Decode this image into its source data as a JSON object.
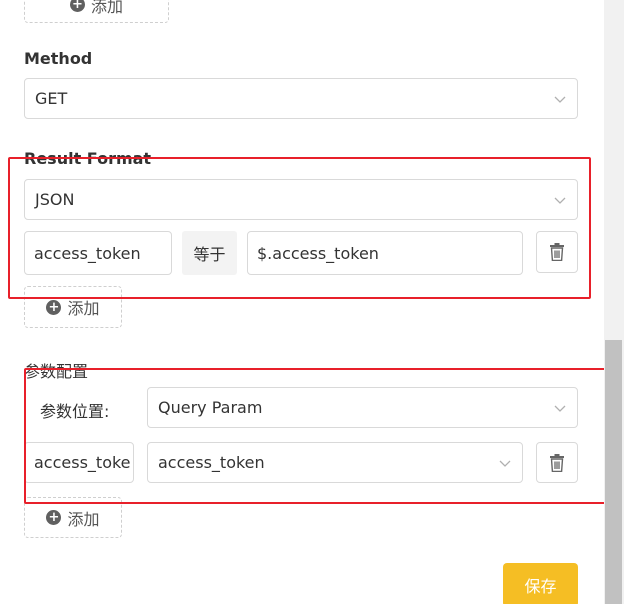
{
  "top_add": {
    "label": "添加"
  },
  "method": {
    "label": "Method",
    "value": "GET"
  },
  "result_format": {
    "label": "Result Format",
    "value": "JSON",
    "rule": {
      "key": "access_token",
      "operator": "等于",
      "value": "$.access_token"
    },
    "add_label": "添加"
  },
  "param_config": {
    "label": "参数配置",
    "position_label": "参数位置:",
    "position_value": "Query Param",
    "row": {
      "key": "access_toke",
      "value": "access_token"
    },
    "add_label": "添加"
  },
  "save": {
    "label": "保存"
  },
  "colors": {
    "highlight": "#e8202a",
    "save_button": "#f5be24",
    "scrollbar_thumb": "#c1c1c1"
  },
  "icons": {
    "plus": "plus-circle-icon",
    "chevron": "chevron-down-icon",
    "trash": "trash-icon"
  }
}
